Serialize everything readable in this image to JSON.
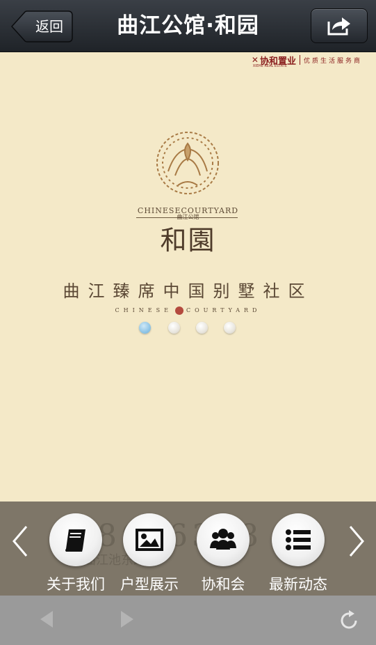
{
  "topbar": {
    "back_label": "返回",
    "title": "曲江公馆·和园",
    "share_icon": "share-icon"
  },
  "brand": {
    "name": "协和置业",
    "english": "XIEHE REAL ESTATE",
    "slogan": "优质生活服务商"
  },
  "hero": {
    "english_title": "CHINESECOURTYARD",
    "small_label": "曲江公馆",
    "chinese_title": "和園",
    "tagline": "曲江臻席中国别墅社区",
    "tagline_en_left": "CHINESE",
    "tagline_en_right": "COURTYARD"
  },
  "carousel": {
    "page_count": 4,
    "active_index": 0
  },
  "menu": {
    "background_text": "8636388",
    "background_subtext": "曲江池东路与",
    "items": [
      {
        "label": "关于我们",
        "icon": "book-icon"
      },
      {
        "label": "户型展示",
        "icon": "image-icon"
      },
      {
        "label": "协和会",
        "icon": "group-icon"
      },
      {
        "label": "最新动态",
        "icon": "list-icon"
      }
    ]
  },
  "colors": {
    "page_background": "#f4e9c8",
    "brand_red": "#8a1e1e",
    "menu_overlay": "#7e7668",
    "active_dot": "#8fc5e6"
  }
}
